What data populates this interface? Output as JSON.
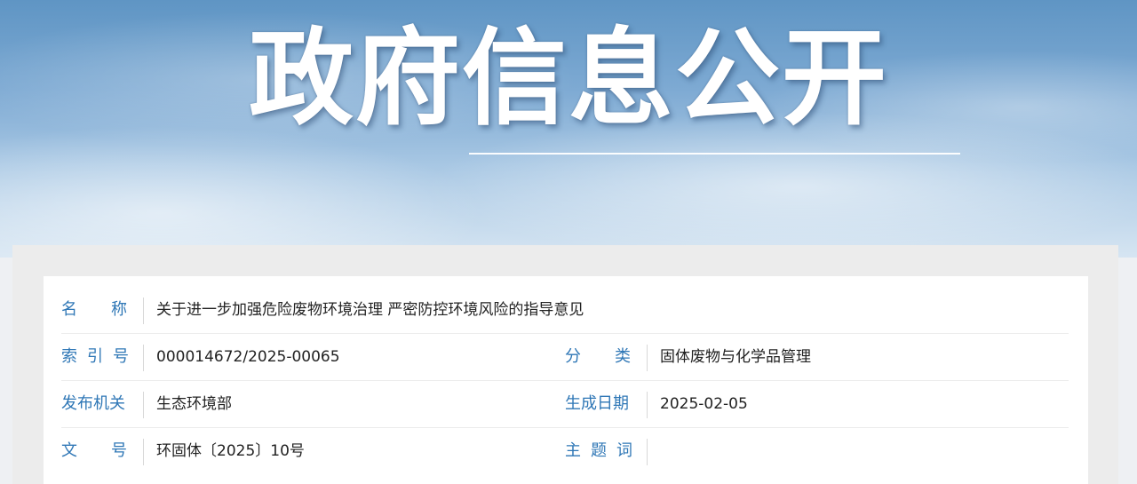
{
  "banner": {
    "title": "政府信息公开"
  },
  "info_table": {
    "rows": [
      {
        "left": {
          "label_chars": [
            "名",
            "称"
          ],
          "value": "关于进一步加强危险废物环境治理 严密防控环境风险的指导意见"
        }
      },
      {
        "left": {
          "label_chars": [
            "索",
            "引",
            "号"
          ],
          "value": "000014672/2025-00065"
        },
        "right": {
          "label_chars": [
            "分",
            "类"
          ],
          "value": "固体废物与化学品管理"
        }
      },
      {
        "left": {
          "label_chars": [
            "发",
            "布",
            "机",
            "关"
          ],
          "value": "生态环境部"
        },
        "right": {
          "label_chars": [
            "生",
            "成",
            "日",
            "期"
          ],
          "value": "2025-02-05"
        }
      },
      {
        "left": {
          "label_chars": [
            "文",
            "号"
          ],
          "value": "环固体〔2025〕10号"
        },
        "right": {
          "label_chars": [
            "主",
            "题",
            "词"
          ],
          "value": ""
        }
      }
    ]
  }
}
